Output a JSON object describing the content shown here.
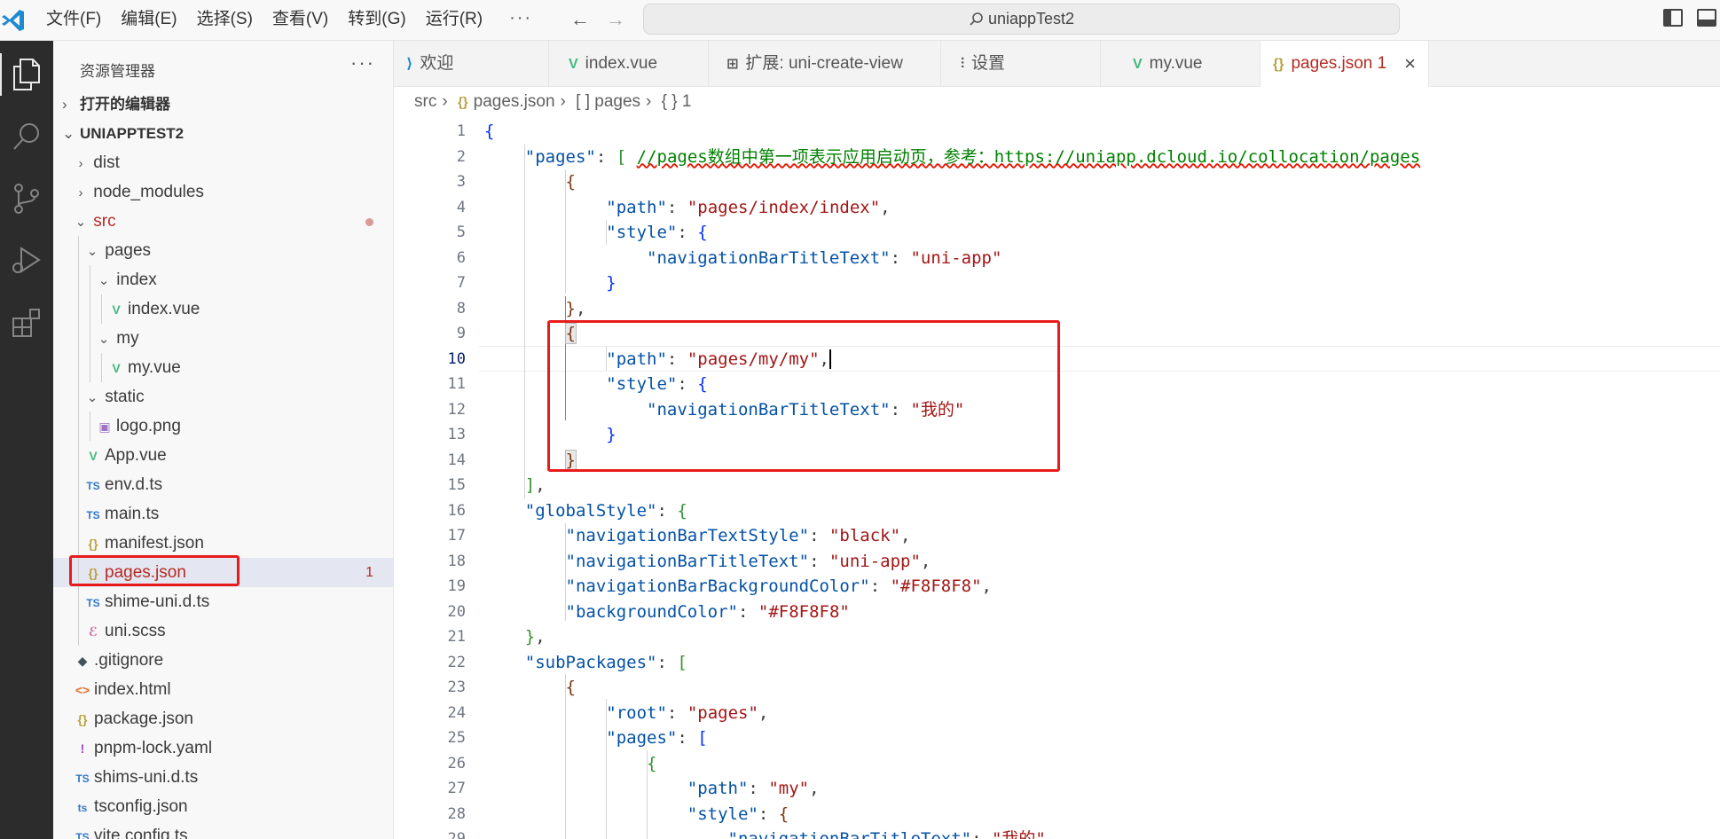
{
  "titlebar": {
    "menu": [
      "文件(F)",
      "编辑(E)",
      "选择(S)",
      "查看(V)",
      "转到(G)",
      "运行(R)"
    ],
    "menu_more": "···",
    "search_text": "uniappTest2"
  },
  "sidebar": {
    "title": "资源管理器",
    "more": "···",
    "open_editors": "打开的编辑器",
    "project": "UNIAPPTEST2",
    "items": [
      {
        "label": "dist",
        "icon": "chevron-right"
      },
      {
        "label": "node_modules",
        "icon": "chevron-right"
      },
      {
        "label": "src",
        "icon": "chevron-down"
      },
      {
        "label": "pages",
        "icon": "chevron-down"
      },
      {
        "label": "index",
        "icon": "chevron-down"
      },
      {
        "label": "index.vue",
        "icon": "vue-icon"
      },
      {
        "label": "my",
        "icon": "chevron-down"
      },
      {
        "label": "my.vue",
        "icon": "vue-icon"
      },
      {
        "label": "static",
        "icon": "chevron-down"
      },
      {
        "label": "logo.png",
        "icon": "image-icon"
      },
      {
        "label": "App.vue",
        "icon": "vue-icon"
      },
      {
        "label": "env.d.ts",
        "icon": "ts-icon"
      },
      {
        "label": "main.ts",
        "icon": "ts-icon"
      },
      {
        "label": "manifest.json",
        "icon": "json-icon"
      },
      {
        "label": "pages.json",
        "icon": "json-icon",
        "badge": "1"
      },
      {
        "label": "shime-uni.d.ts",
        "icon": "ts-icon"
      },
      {
        "label": "uni.scss",
        "icon": "scss-icon"
      },
      {
        "label": ".gitignore",
        "icon": "git-icon"
      },
      {
        "label": "index.html",
        "icon": "html-icon"
      },
      {
        "label": "package.json",
        "icon": "json-icon"
      },
      {
        "label": "pnpm-lock.yaml",
        "icon": "yaml-icon"
      },
      {
        "label": "shims-uni.d.ts",
        "icon": "ts-icon"
      },
      {
        "label": "tsconfig.json",
        "icon": "tsconfig-icon"
      },
      {
        "label": "vite.config.ts",
        "icon": "ts-icon"
      }
    ]
  },
  "tabs": [
    {
      "label": "欢迎",
      "icon": "vscode-icon"
    },
    {
      "label": "index.vue",
      "icon": "vue-icon"
    },
    {
      "label": "扩展: uni-create-view",
      "icon": "extensions-icon"
    },
    {
      "label": "设置",
      "icon": "settings-icon"
    },
    {
      "label": "my.vue",
      "icon": "vue-icon"
    },
    {
      "label": "pages.json 1",
      "icon": "json-icon",
      "active": true
    }
  ],
  "breadcrumb": [
    "src",
    "pages.json",
    "[ ] pages",
    "{ } 1"
  ],
  "editor": {
    "line_numbers": [
      "1",
      "2",
      "3",
      "4",
      "5",
      "6",
      "7",
      "8",
      "9",
      "10",
      "11",
      "12",
      "13",
      "14",
      "15",
      "16",
      "17",
      "18",
      "19",
      "20",
      "21",
      "22",
      "23",
      "24",
      "25",
      "26",
      "27",
      "28",
      "29"
    ],
    "current_line": "10",
    "comment": "//pages数组中第一项表示应用启动页，参考：https://uniapp.dcloud.io/collocation/pages"
  }
}
